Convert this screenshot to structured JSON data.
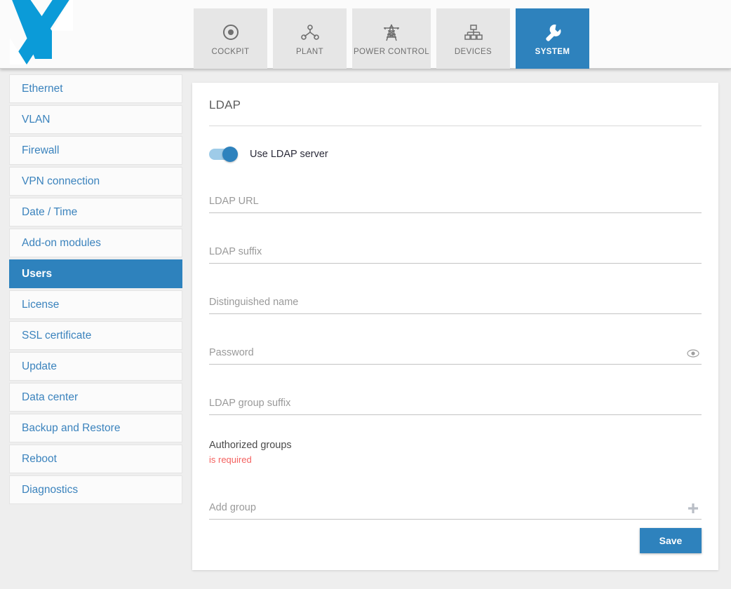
{
  "brand": {
    "logo_icon": "x-logo-icon",
    "logo_color": "#0b9bd8"
  },
  "theme": {
    "accent": "#2e82bd",
    "link": "#3b83bd",
    "error": "#f4615f",
    "page_bg": "#eeeeee",
    "tab_bg": "#e6e6e6",
    "panel_bg": "#ffffff"
  },
  "nav": {
    "tabs": [
      {
        "label": "COCKPIT",
        "icon": "target-icon",
        "active": false
      },
      {
        "label": "PLANT",
        "icon": "plant-nodes-icon",
        "active": false
      },
      {
        "label": "POWER CONTROL",
        "icon": "power-pylon-icon",
        "active": false
      },
      {
        "label": "DEVICES",
        "icon": "devices-tree-icon",
        "active": false
      },
      {
        "label": "SYSTEM",
        "icon": "wrench-icon",
        "active": true
      }
    ]
  },
  "sidebar": {
    "items": [
      {
        "label": "Ethernet",
        "active": false
      },
      {
        "label": "VLAN",
        "active": false
      },
      {
        "label": "Firewall",
        "active": false
      },
      {
        "label": "VPN connection",
        "active": false
      },
      {
        "label": "Date / Time",
        "active": false
      },
      {
        "label": "Add-on modules",
        "active": false
      },
      {
        "label": "Users",
        "active": true
      },
      {
        "label": "License",
        "active": false
      },
      {
        "label": "SSL certificate",
        "active": false
      },
      {
        "label": "Update",
        "active": false
      },
      {
        "label": "Data center",
        "active": false
      },
      {
        "label": "Backup and Restore",
        "active": false
      },
      {
        "label": "Reboot",
        "active": false
      },
      {
        "label": "Diagnostics",
        "active": false
      }
    ]
  },
  "panel": {
    "title": "LDAP",
    "toggle": {
      "label": "Use LDAP server",
      "state": "on"
    },
    "fields": [
      {
        "name": "ldap-url",
        "placeholder": "LDAP URL",
        "value": "",
        "affix": ""
      },
      {
        "name": "ldap-suffix",
        "placeholder": "LDAP suffix",
        "value": "",
        "affix": ""
      },
      {
        "name": "distinguished-name",
        "placeholder": "Distinguished name",
        "value": "",
        "affix": ""
      },
      {
        "name": "password",
        "placeholder": "Password",
        "value": "",
        "affix": "eye-icon"
      },
      {
        "name": "ldap-group-suffix",
        "placeholder": "LDAP group suffix",
        "value": "",
        "affix": ""
      }
    ],
    "authorized_groups": {
      "label": "Authorized groups",
      "error": "is required"
    },
    "add_group": {
      "placeholder": "Add group",
      "value": "",
      "affix": "plus-icon"
    },
    "save_label": "Save"
  }
}
